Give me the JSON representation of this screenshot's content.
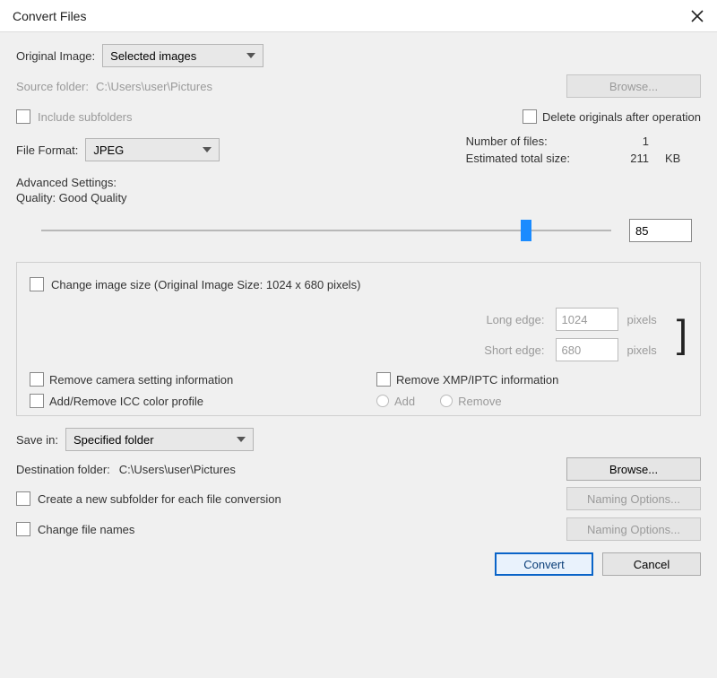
{
  "title": "Convert Files",
  "original_image_label": "Original Image:",
  "original_image_value": "Selected images",
  "source_folder_label": "Source folder:",
  "source_folder_path": "C:\\Users\\user\\Pictures",
  "browse_label": "Browse...",
  "include_subfolders_label": "Include subfolders",
  "delete_originals_label": "Delete originals after operation",
  "file_format_label": "File Format:",
  "file_format_value": "JPEG",
  "number_of_files_label": "Number of files:",
  "number_of_files_value": "1",
  "estimated_size_label": "Estimated total size:",
  "estimated_size_value": "211",
  "estimated_size_unit": "KB",
  "advanced_settings_label": "Advanced Settings:",
  "quality_label": "Quality: Good Quality",
  "quality_value": "85",
  "quality_percent": 85,
  "change_size_label": "Change image size (Original Image Size: 1024 x 680 pixels)",
  "long_edge_label": "Long edge:",
  "long_edge_value": "1024",
  "short_edge_label": "Short edge:",
  "short_edge_value": "680",
  "pixels_label": "pixels",
  "remove_camera_label": "Remove camera setting information",
  "remove_xmp_label": "Remove XMP/IPTC information",
  "icc_label": "Add/Remove ICC color profile",
  "icc_add_label": "Add",
  "icc_remove_label": "Remove",
  "save_in_label": "Save in:",
  "save_in_value": "Specified folder",
  "destination_folder_label": "Destination folder:",
  "destination_folder_path": "C:\\Users\\user\\Pictures",
  "create_subfolder_label": "Create a new subfolder for each file conversion",
  "naming_options_label": "Naming Options...",
  "change_filenames_label": "Change file names",
  "convert_label": "Convert",
  "cancel_label": "Cancel"
}
